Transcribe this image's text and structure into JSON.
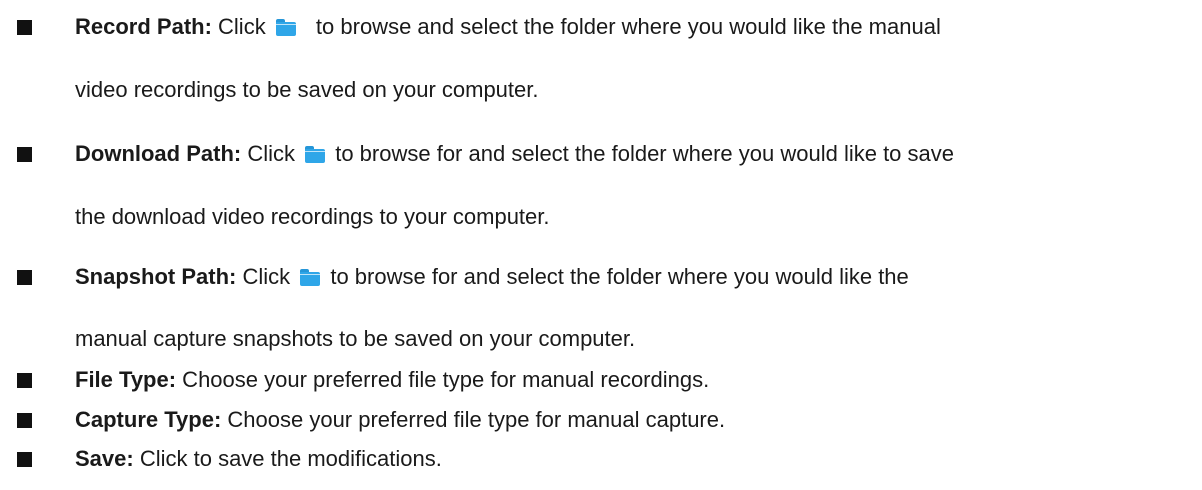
{
  "items": [
    {
      "term": "Record Path:",
      "before_icon": " Click ",
      "icon": "folder-icon",
      "line1_rest": " to browse and select the folder where you would like the manual",
      "line2": "video recordings to be saved on your computer."
    },
    {
      "term": "Download Path:",
      "before_icon": " Click ",
      "icon": "folder-icon",
      "line1_rest": " to browse for and select the folder where you would like to save",
      "line2": "the download video recordings to your computer."
    },
    {
      "term": "Snapshot Path:",
      "before_icon": " Click ",
      "icon": "folder-icon",
      "line1_rest": " to browse for and select the folder where you would like the",
      "line2": "manual capture snapshots to be saved on your computer."
    },
    {
      "term": "File Type:",
      "text": " Choose your preferred file type for manual recordings."
    },
    {
      "term": "Capture Type:",
      "text": " Choose your preferred file type for manual capture."
    },
    {
      "term": "Save:",
      "text": " Click to save the modifications."
    }
  ],
  "colors": {
    "folder_icon": "#2fa6e8",
    "text": "#1a1a1a",
    "bullet": "#111111"
  }
}
